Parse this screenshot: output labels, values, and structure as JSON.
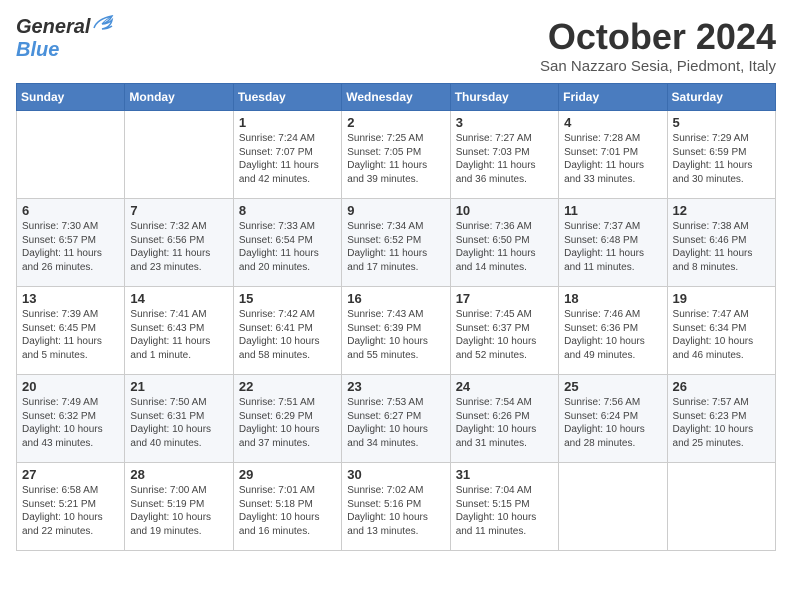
{
  "header": {
    "logo_general": "General",
    "logo_blue": "Blue",
    "month": "October 2024",
    "location": "San Nazzaro Sesia, Piedmont, Italy"
  },
  "weekdays": [
    "Sunday",
    "Monday",
    "Tuesday",
    "Wednesday",
    "Thursday",
    "Friday",
    "Saturday"
  ],
  "weeks": [
    [
      {
        "day": "",
        "sunrise": "",
        "sunset": "",
        "daylight": ""
      },
      {
        "day": "",
        "sunrise": "",
        "sunset": "",
        "daylight": ""
      },
      {
        "day": "1",
        "sunrise": "Sunrise: 7:24 AM",
        "sunset": "Sunset: 7:07 PM",
        "daylight": "Daylight: 11 hours and 42 minutes."
      },
      {
        "day": "2",
        "sunrise": "Sunrise: 7:25 AM",
        "sunset": "Sunset: 7:05 PM",
        "daylight": "Daylight: 11 hours and 39 minutes."
      },
      {
        "day": "3",
        "sunrise": "Sunrise: 7:27 AM",
        "sunset": "Sunset: 7:03 PM",
        "daylight": "Daylight: 11 hours and 36 minutes."
      },
      {
        "day": "4",
        "sunrise": "Sunrise: 7:28 AM",
        "sunset": "Sunset: 7:01 PM",
        "daylight": "Daylight: 11 hours and 33 minutes."
      },
      {
        "day": "5",
        "sunrise": "Sunrise: 7:29 AM",
        "sunset": "Sunset: 6:59 PM",
        "daylight": "Daylight: 11 hours and 30 minutes."
      }
    ],
    [
      {
        "day": "6",
        "sunrise": "Sunrise: 7:30 AM",
        "sunset": "Sunset: 6:57 PM",
        "daylight": "Daylight: 11 hours and 26 minutes."
      },
      {
        "day": "7",
        "sunrise": "Sunrise: 7:32 AM",
        "sunset": "Sunset: 6:56 PM",
        "daylight": "Daylight: 11 hours and 23 minutes."
      },
      {
        "day": "8",
        "sunrise": "Sunrise: 7:33 AM",
        "sunset": "Sunset: 6:54 PM",
        "daylight": "Daylight: 11 hours and 20 minutes."
      },
      {
        "day": "9",
        "sunrise": "Sunrise: 7:34 AM",
        "sunset": "Sunset: 6:52 PM",
        "daylight": "Daylight: 11 hours and 17 minutes."
      },
      {
        "day": "10",
        "sunrise": "Sunrise: 7:36 AM",
        "sunset": "Sunset: 6:50 PM",
        "daylight": "Daylight: 11 hours and 14 minutes."
      },
      {
        "day": "11",
        "sunrise": "Sunrise: 7:37 AM",
        "sunset": "Sunset: 6:48 PM",
        "daylight": "Daylight: 11 hours and 11 minutes."
      },
      {
        "day": "12",
        "sunrise": "Sunrise: 7:38 AM",
        "sunset": "Sunset: 6:46 PM",
        "daylight": "Daylight: 11 hours and 8 minutes."
      }
    ],
    [
      {
        "day": "13",
        "sunrise": "Sunrise: 7:39 AM",
        "sunset": "Sunset: 6:45 PM",
        "daylight": "Daylight: 11 hours and 5 minutes."
      },
      {
        "day": "14",
        "sunrise": "Sunrise: 7:41 AM",
        "sunset": "Sunset: 6:43 PM",
        "daylight": "Daylight: 11 hours and 1 minute."
      },
      {
        "day": "15",
        "sunrise": "Sunrise: 7:42 AM",
        "sunset": "Sunset: 6:41 PM",
        "daylight": "Daylight: 10 hours and 58 minutes."
      },
      {
        "day": "16",
        "sunrise": "Sunrise: 7:43 AM",
        "sunset": "Sunset: 6:39 PM",
        "daylight": "Daylight: 10 hours and 55 minutes."
      },
      {
        "day": "17",
        "sunrise": "Sunrise: 7:45 AM",
        "sunset": "Sunset: 6:37 PM",
        "daylight": "Daylight: 10 hours and 52 minutes."
      },
      {
        "day": "18",
        "sunrise": "Sunrise: 7:46 AM",
        "sunset": "Sunset: 6:36 PM",
        "daylight": "Daylight: 10 hours and 49 minutes."
      },
      {
        "day": "19",
        "sunrise": "Sunrise: 7:47 AM",
        "sunset": "Sunset: 6:34 PM",
        "daylight": "Daylight: 10 hours and 46 minutes."
      }
    ],
    [
      {
        "day": "20",
        "sunrise": "Sunrise: 7:49 AM",
        "sunset": "Sunset: 6:32 PM",
        "daylight": "Daylight: 10 hours and 43 minutes."
      },
      {
        "day": "21",
        "sunrise": "Sunrise: 7:50 AM",
        "sunset": "Sunset: 6:31 PM",
        "daylight": "Daylight: 10 hours and 40 minutes."
      },
      {
        "day": "22",
        "sunrise": "Sunrise: 7:51 AM",
        "sunset": "Sunset: 6:29 PM",
        "daylight": "Daylight: 10 hours and 37 minutes."
      },
      {
        "day": "23",
        "sunrise": "Sunrise: 7:53 AM",
        "sunset": "Sunset: 6:27 PM",
        "daylight": "Daylight: 10 hours and 34 minutes."
      },
      {
        "day": "24",
        "sunrise": "Sunrise: 7:54 AM",
        "sunset": "Sunset: 6:26 PM",
        "daylight": "Daylight: 10 hours and 31 minutes."
      },
      {
        "day": "25",
        "sunrise": "Sunrise: 7:56 AM",
        "sunset": "Sunset: 6:24 PM",
        "daylight": "Daylight: 10 hours and 28 minutes."
      },
      {
        "day": "26",
        "sunrise": "Sunrise: 7:57 AM",
        "sunset": "Sunset: 6:23 PM",
        "daylight": "Daylight: 10 hours and 25 minutes."
      }
    ],
    [
      {
        "day": "27",
        "sunrise": "Sunrise: 6:58 AM",
        "sunset": "Sunset: 5:21 PM",
        "daylight": "Daylight: 10 hours and 22 minutes."
      },
      {
        "day": "28",
        "sunrise": "Sunrise: 7:00 AM",
        "sunset": "Sunset: 5:19 PM",
        "daylight": "Daylight: 10 hours and 19 minutes."
      },
      {
        "day": "29",
        "sunrise": "Sunrise: 7:01 AM",
        "sunset": "Sunset: 5:18 PM",
        "daylight": "Daylight: 10 hours and 16 minutes."
      },
      {
        "day": "30",
        "sunrise": "Sunrise: 7:02 AM",
        "sunset": "Sunset: 5:16 PM",
        "daylight": "Daylight: 10 hours and 13 minutes."
      },
      {
        "day": "31",
        "sunrise": "Sunrise: 7:04 AM",
        "sunset": "Sunset: 5:15 PM",
        "daylight": "Daylight: 10 hours and 11 minutes."
      },
      {
        "day": "",
        "sunrise": "",
        "sunset": "",
        "daylight": ""
      },
      {
        "day": "",
        "sunrise": "",
        "sunset": "",
        "daylight": ""
      }
    ]
  ]
}
